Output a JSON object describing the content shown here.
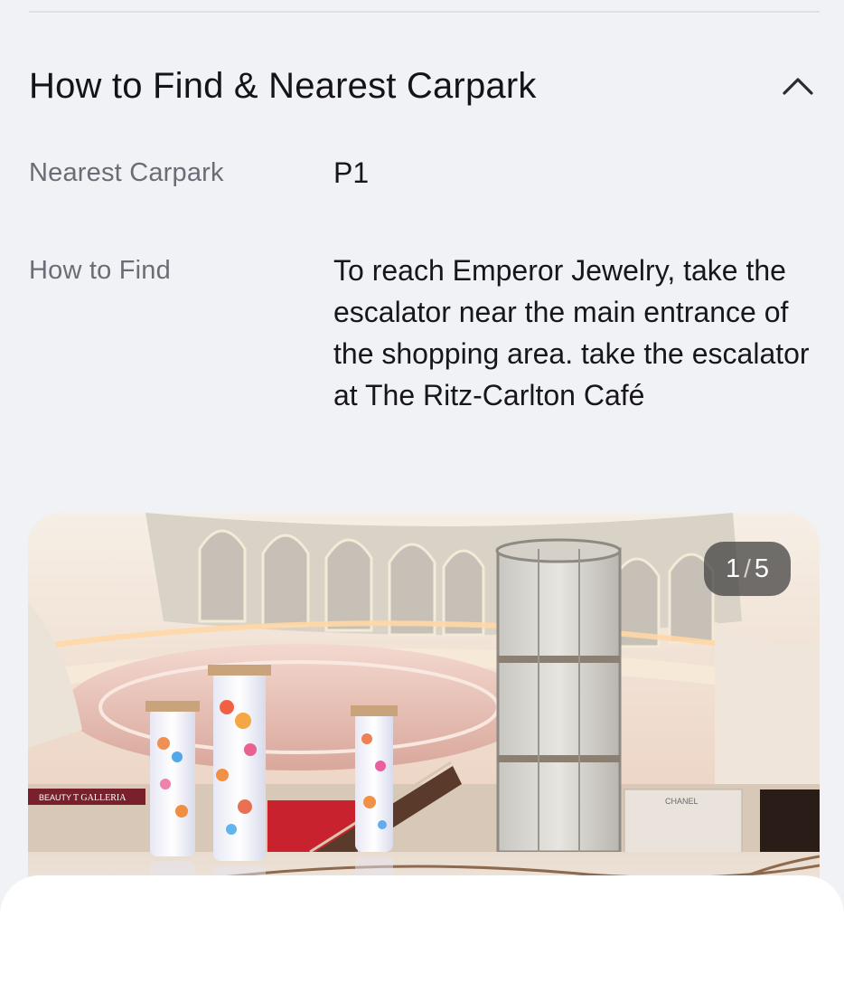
{
  "section": {
    "title": "How to Find & Nearest Carpark",
    "expanded": true
  },
  "details": {
    "carpark_label": "Nearest Carpark",
    "carpark_value": "P1",
    "howto_label": "How to Find",
    "howto_value": "To reach Emperor Jewelry, take the escalator near the main entrance of the shopping area. take the escalator at The Ritz-Carlton Café"
  },
  "gallery": {
    "current": "1",
    "total": "5",
    "signs": {
      "galleria": "T GALLERIA",
      "beauty": "BEAUTY",
      "chanel": "CHANEL"
    }
  },
  "icons": {
    "collapse": "chevron-up-icon"
  }
}
